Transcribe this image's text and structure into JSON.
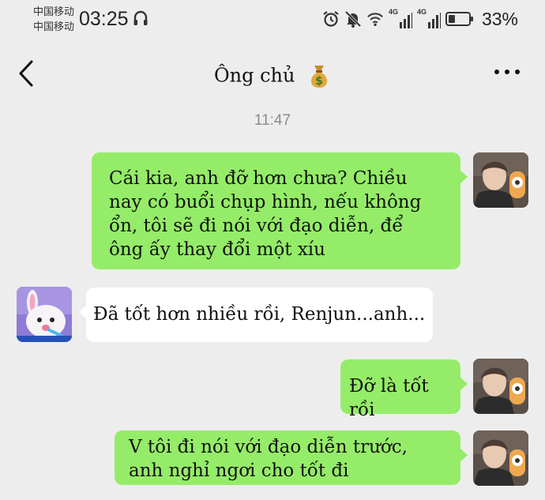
{
  "status_bar": {
    "carrier_1": "中国移动",
    "carrier_2": "中国移动",
    "time": "03:25",
    "network_1": "4G",
    "network_2": "4G",
    "battery_percent": "33%",
    "battery_level": 0.33
  },
  "header": {
    "title": "Ông chủ",
    "title_emoji_icon": "money-bag-icon"
  },
  "chat": {
    "timestamp": "11:47",
    "messages": [
      {
        "direction": "out",
        "text": "Cái kia, anh đỡ hơn chưa? Chiều nay có buổi chụp hình, nếu không ổn, tôi sẽ đi nói với đạo diễn, để ông ấy thay đổi một xíu"
      },
      {
        "direction": "in",
        "text": "Đã tốt hơn nhiều rồi, Renjun...anh..."
      },
      {
        "direction": "out",
        "text": "Đỡ là tốt rồi"
      },
      {
        "direction": "out",
        "text": "V tôi đi nói với đạo diễn trước, anh nghỉ ngơi cho tốt đi"
      }
    ]
  },
  "colors": {
    "background": "#ededed",
    "outgoing_bubble": "#95ec69",
    "incoming_bubble": "#ffffff"
  }
}
